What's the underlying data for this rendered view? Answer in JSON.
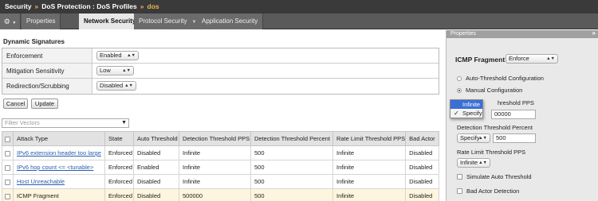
{
  "breadcrumb": {
    "items": [
      "Security",
      "DoS Protection : DoS Profiles"
    ],
    "leaf": "dos"
  },
  "tabs": [
    {
      "label": "Properties"
    },
    {
      "label": "Network Security"
    },
    {
      "label": "Protocol Security"
    },
    {
      "label": "Application Security"
    }
  ],
  "dynamic_signatures": {
    "title": "Dynamic Signatures",
    "rows": [
      {
        "label": "Enforcement",
        "value": "Enabled"
      },
      {
        "label": "Mitigation Sensitivity",
        "value": "Low"
      },
      {
        "label": "Redirection/Scrubbing",
        "value": "Disabled"
      }
    ]
  },
  "buttons": {
    "cancel": "Cancel",
    "update": "Update"
  },
  "filter": {
    "placeholder": "Filter Vectors"
  },
  "table": {
    "columns": [
      "Attack Type",
      "State",
      "Auto Threshold",
      "Detection Threshold PPS",
      "Detection Threshold Percent",
      "Rate Limit Threshold PPS",
      "Bad Actor"
    ],
    "rows": [
      {
        "attack": "IPv6 extension header too large",
        "state": "Enforced",
        "auto": "Disabled",
        "dpps": "Infinite",
        "dpct": "500",
        "rl": "Infinite",
        "bad": "Disabled"
      },
      {
        "attack": "IPv6 hop count <= <tunable>",
        "state": "Enforced",
        "auto": "Enabled",
        "dpps": "Infinite",
        "dpct": "500",
        "rl": "Infinite",
        "bad": "Disabled"
      },
      {
        "attack": "Host Unreachable",
        "state": "Enforced",
        "auto": "Disabled",
        "dpps": "Infinite",
        "dpct": "500",
        "rl": "Infinite",
        "bad": "Disabled"
      },
      {
        "attack": "ICMP Fragment",
        "state": "Enforced",
        "auto": "Disabled",
        "dpps": "500000",
        "dpct": "500",
        "rl": "Infinite",
        "bad": "Disabled"
      }
    ]
  },
  "properties": {
    "header": "Properties",
    "title": "ICMP Fragment",
    "mode": "Enforce",
    "auto_config": "Auto-Threshold Configuration",
    "manual_config": "Manual Configuration",
    "detection_pps_label_partial": "hreshold PPS",
    "detection_pps_value": "00000",
    "detection_percent_label": "Detection Threshold Percent",
    "detection_percent_mode": "Specify",
    "detection_percent_value": "500",
    "rate_limit_label": "Rate Limit Threshold PPS",
    "rate_limit_mode": "Infinite",
    "simulate": "Simulate Auto Threshold",
    "bad_actor": "Bad Actor Detection"
  },
  "dropdown": {
    "options": [
      "Infinite",
      "Specify"
    ],
    "highlighted": "Infinite",
    "checked": "Specify"
  },
  "colors": {
    "accent": "#e9b84a",
    "link": "#2a5db0",
    "highlight_row": "#fdf5dd",
    "selection": "#3b6fd4"
  },
  "icons": {
    "gear": "gear-icon",
    "filter": "funnel-icon",
    "collapse": "double-chevron-right-icon"
  }
}
